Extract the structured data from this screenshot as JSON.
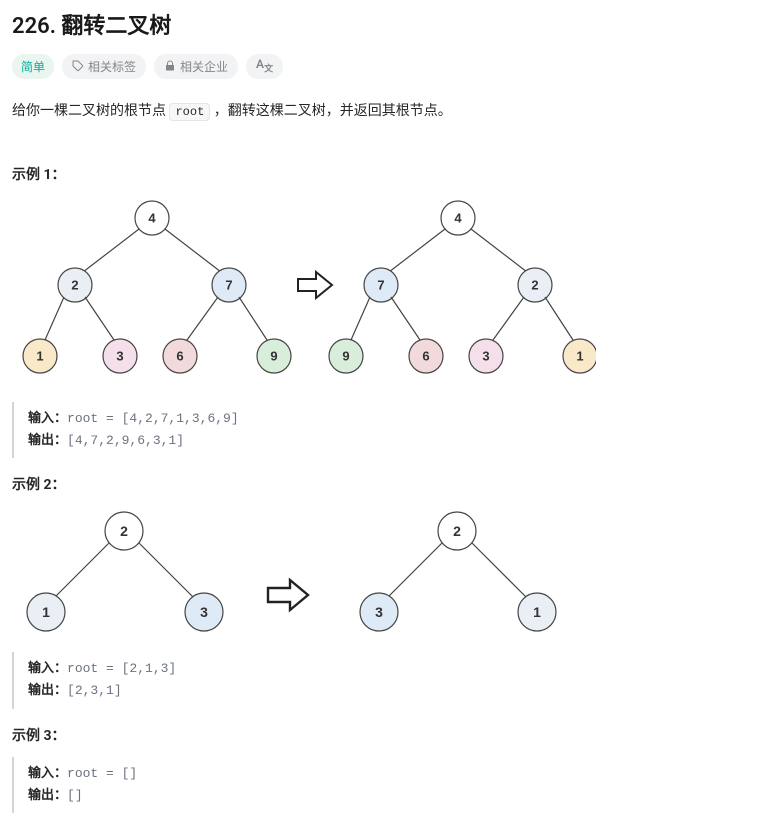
{
  "title": "226. 翻转二叉树",
  "difficulty": "简单",
  "tagButtons": {
    "related": "相关标签",
    "companies": "相关企业"
  },
  "description": {
    "pre": "给你一棵二叉树的根节点 ",
    "code": "root",
    "post": " ，翻转这棵二叉树，并返回其根节点。"
  },
  "example1Label": "示例 1：",
  "example2Label": "示例 2：",
  "example3Label": "示例 3：",
  "ioLabels": {
    "input": "输入：",
    "output": "输出："
  },
  "example1": {
    "input": "root = [4,2,7,1,3,6,9]",
    "output": "[4,7,2,9,6,3,1]"
  },
  "example2": {
    "input": "root = [2,1,3]",
    "output": "[2,3,1]"
  },
  "example3": {
    "input": "root = []",
    "output": "[]"
  },
  "tree1": {
    "root": "4",
    "leftL1": "2",
    "rightL1": "7",
    "leaf1": "1",
    "leaf2": "3",
    "leaf3": "6",
    "leaf4": "9"
  },
  "tree2": {
    "root": "4",
    "leftL1": "7",
    "rightL1": "2",
    "leaf1": "9",
    "leaf2": "6",
    "leaf3": "3",
    "leaf4": "1"
  },
  "tree3": {
    "root": "2",
    "left": "1",
    "right": "3"
  },
  "tree4": {
    "root": "2",
    "left": "3",
    "right": "1"
  }
}
